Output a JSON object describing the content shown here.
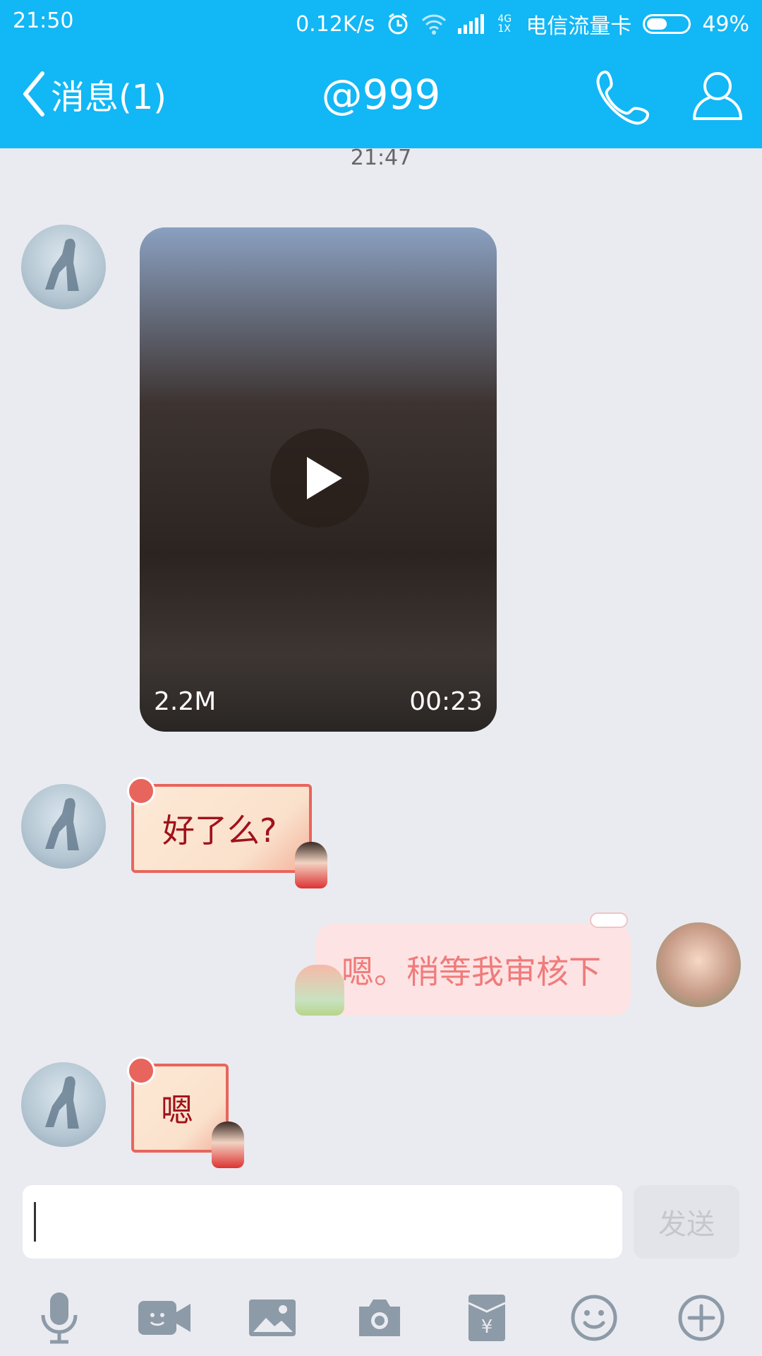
{
  "status_bar": {
    "time": "21:50",
    "speed": "0.12K/s",
    "net_small": "4G\n1X",
    "carrier": "电信流量卡",
    "battery": "49%",
    "battery_level": 0.49,
    "icons": [
      "alarm-icon",
      "wifi-icon",
      "signal-icon",
      "battery-icon"
    ]
  },
  "header": {
    "back_label": "消息(1)",
    "title": "@999",
    "icons": [
      "phone-icon",
      "profile-icon"
    ]
  },
  "chat": {
    "timestamp": "21:47",
    "video": {
      "size": "2.2M",
      "duration": "00:23"
    },
    "msg1": "好了么?",
    "msg2": "嗯。稍等我审核下",
    "msg3": "嗯"
  },
  "input": {
    "value": "",
    "send_label": "发送"
  },
  "toolbar": {
    "icons": [
      "microphone-icon",
      "video-call-icon",
      "image-icon",
      "camera-icon",
      "red-packet-icon",
      "emoji-icon",
      "plus-icon"
    ]
  },
  "colors": {
    "accent": "#12b7f5",
    "background": "#eaebf0",
    "bubble_red": "#e8655d",
    "bubble_pink": "#fde3e3"
  }
}
